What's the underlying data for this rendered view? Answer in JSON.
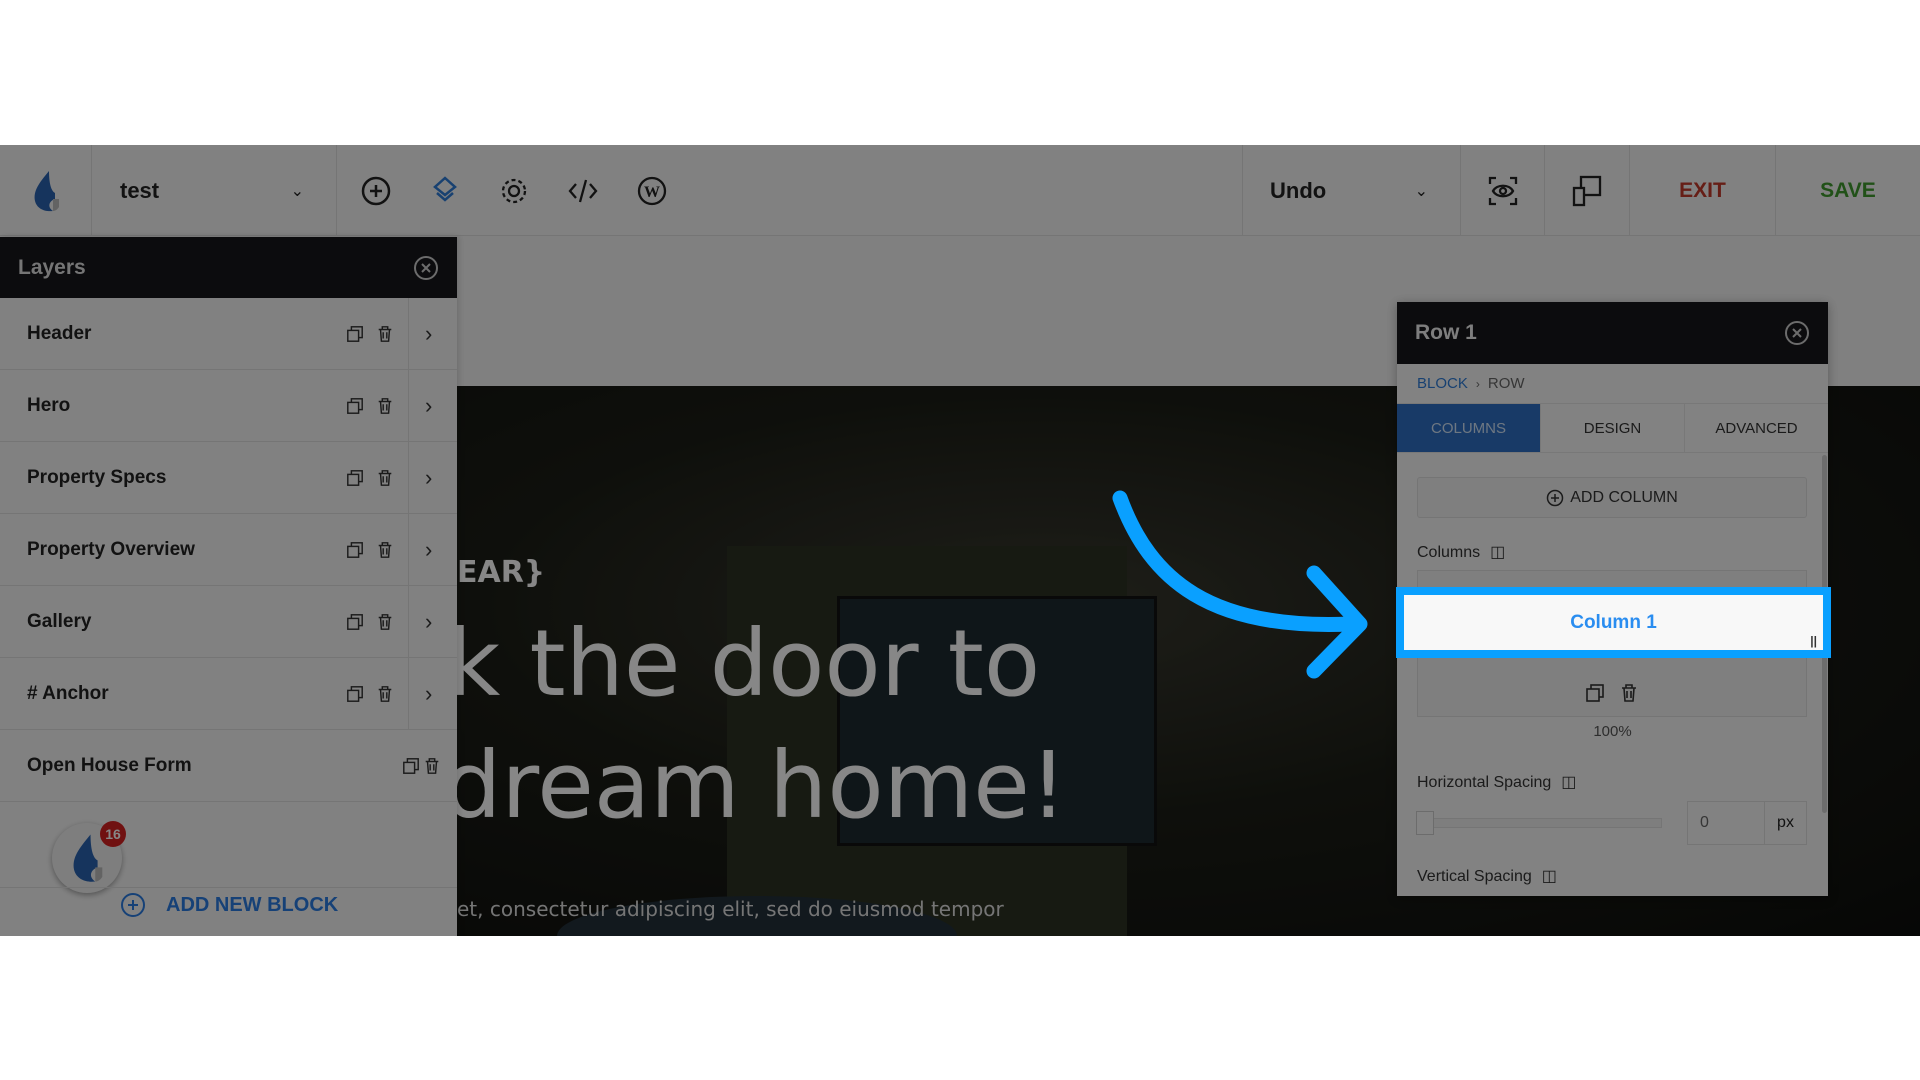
{
  "toolbar": {
    "page_select": "test",
    "undo_label": "Undo",
    "exit_label": "EXIT",
    "save_label": "SAVE",
    "icons": [
      "add-icon",
      "layers-icon",
      "settings-icon",
      "code-icon",
      "wordpress-icon",
      "preview-icon",
      "responsive-icon"
    ],
    "colors": {
      "exit": "#c0392b",
      "save": "#3f9a2e",
      "active_icon": "#2e7bd6"
    }
  },
  "layers": {
    "title": "Layers",
    "items": [
      {
        "label": "Header"
      },
      {
        "label": "Hero"
      },
      {
        "label": "Property Specs"
      },
      {
        "label": "Property Overview"
      },
      {
        "label": "Gallery"
      },
      {
        "label": "# Anchor"
      },
      {
        "label": "Open House Form"
      }
    ],
    "notification_count": "16",
    "add_block_label": "ADD NEW BLOCK"
  },
  "hero": {
    "eyebrow": "EAR}",
    "line1": "k the door to",
    "line2": "dream home!",
    "body": "et, consectetur adipiscing elit, sed do eiusmod tempor"
  },
  "row_panel": {
    "title": "Row 1",
    "breadcrumb": [
      "BLOCK",
      "ROW"
    ],
    "tabs": [
      {
        "label": "COLUMNS",
        "active": true
      },
      {
        "label": "DESIGN"
      },
      {
        "label": "ADVANCED"
      }
    ],
    "add_column_label": "ADD COLUMN",
    "columns_label": "Columns",
    "column_name": "Column 1",
    "column_width": "100%",
    "horizontal_spacing_label": "Horizontal Spacing",
    "horizontal_spacing_value": "0",
    "horizontal_spacing_unit": "px",
    "horizontal_spacing_slider": 0,
    "vertical_spacing_label": "Vertical Spacing"
  },
  "annotation": {
    "color": "#0aa0ff"
  }
}
